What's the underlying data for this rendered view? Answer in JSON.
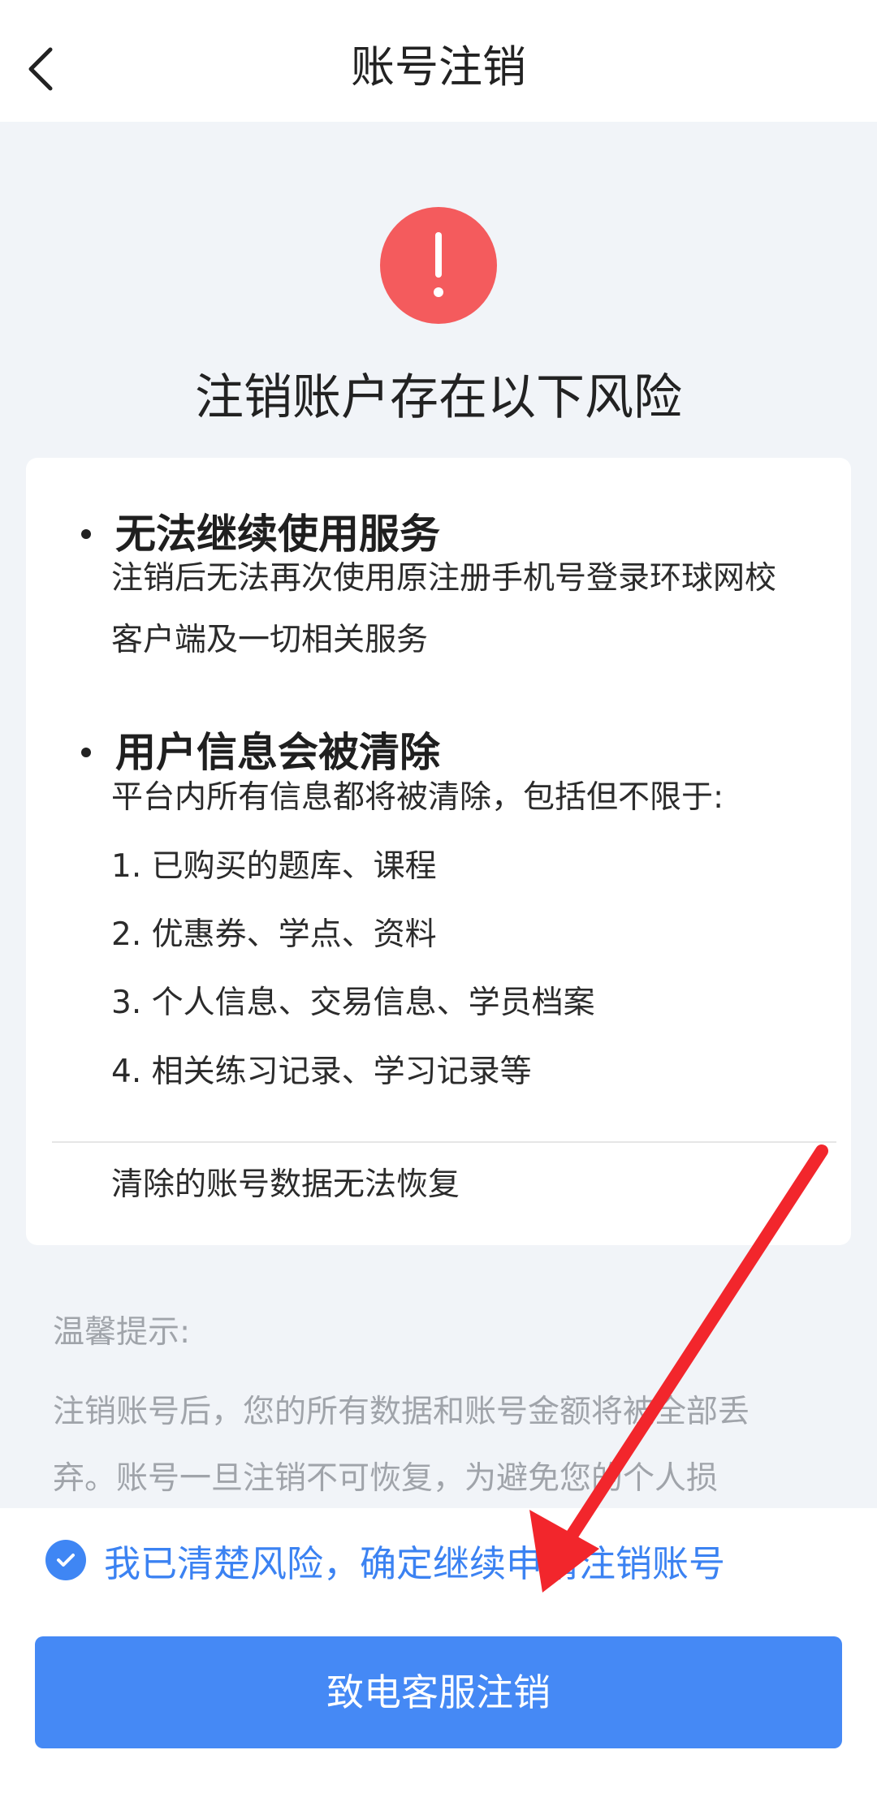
{
  "header": {
    "title": "账号注销",
    "back_icon": "chevron-left-icon"
  },
  "alert": {
    "icon": "exclamation-icon",
    "color": "#f45b5d",
    "heading": "注销账户存在以下风险"
  },
  "risks": [
    {
      "title": "无法继续使用服务",
      "lines": [
        "注销后无法再次使用原注册手机号登录环球网校",
        "客户端及一切相关服务"
      ]
    },
    {
      "title": "用户信息会被清除",
      "lines": [
        "平台内所有信息都将被清除，包括但不限于:",
        "1. 已购买的题库、课程",
        "2. 优惠券、学点、资料",
        "3. 个人信息、交易信息、学员档案",
        "4. 相关练习记录、学习记录等"
      ]
    }
  ],
  "card_footer": "清除的账号数据无法恢复",
  "tips": {
    "title": "温馨提示:",
    "lines": [
      "注销账号后，您的所有数据和账号金额将被全部丢",
      "弃。账号一旦注销不可恢复，为避免您的个人损"
    ]
  },
  "agreement": {
    "checked": true,
    "text": "我已清楚风险，确定继续申请注销账号"
  },
  "actions": {
    "confirm_label": "致电客服注销"
  },
  "colors": {
    "accent": "#4589f5",
    "danger": "#f45b5d",
    "annotation_arrow": "#f2262c"
  }
}
